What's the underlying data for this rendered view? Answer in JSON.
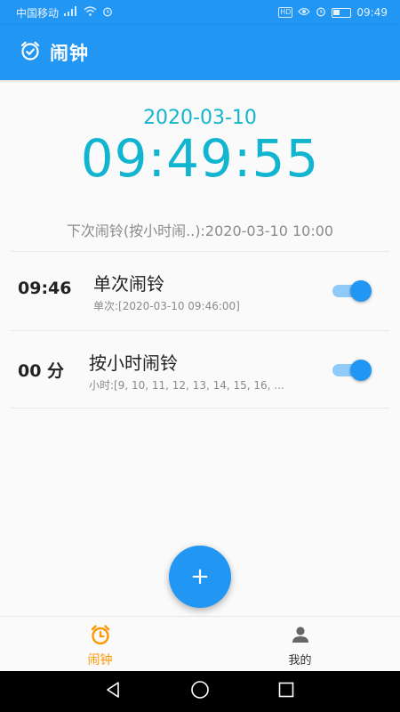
{
  "status_bar": {
    "carrier": "中国移动",
    "time": "09:49",
    "hd_badge": "HD"
  },
  "app_bar": {
    "title": "闹钟",
    "icon": "alarm-clock-icon"
  },
  "clock": {
    "date": "2020-03-10",
    "time": "09:49:55"
  },
  "next_alarm": "下次闹铃(按小时闹..):2020-03-10 10:00",
  "alarms": [
    {
      "time_label": "09:46",
      "name": "单次闹铃",
      "description": "单次:[2020-03-10 09:46:00]",
      "enabled": true
    },
    {
      "time_label": "00 分",
      "name": "按小时闹铃",
      "description": "小时:[9, 10, 11, 12, 13, 14, 15, 16, ...",
      "enabled": true
    }
  ],
  "fab": {
    "label": "+"
  },
  "bottom_nav": [
    {
      "label": "闹钟",
      "icon": "alarm-clock-icon",
      "active": true
    },
    {
      "label": "我的",
      "icon": "person-icon",
      "active": false
    }
  ],
  "colors": {
    "primary": "#2196f3",
    "clock_text": "#12b5cf",
    "active_tab": "#ff9800",
    "switch_track": "#90caf9"
  }
}
